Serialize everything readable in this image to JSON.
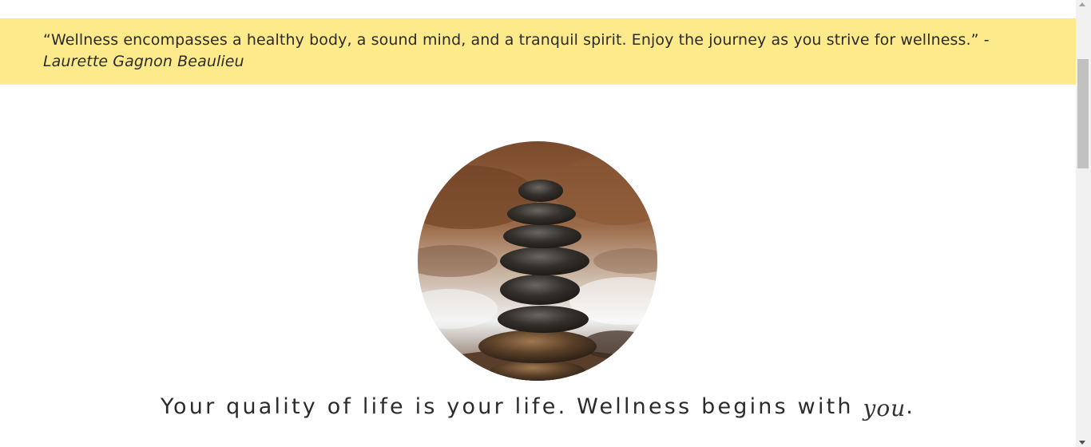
{
  "quote": {
    "text": "“Wellness encompasses a healthy body, a sound mind, and a tranquil spirit. Enjoy the journey as you strive for wellness.” -",
    "author": "Laurette Gagnon Beaulieu"
  },
  "tagline": {
    "text": "Your quality of life is your life. Wellness begins with",
    "emphasis": "you",
    "end": "."
  },
  "colors": {
    "banner": "#fdea8b",
    "text": "#2b2b2b"
  }
}
